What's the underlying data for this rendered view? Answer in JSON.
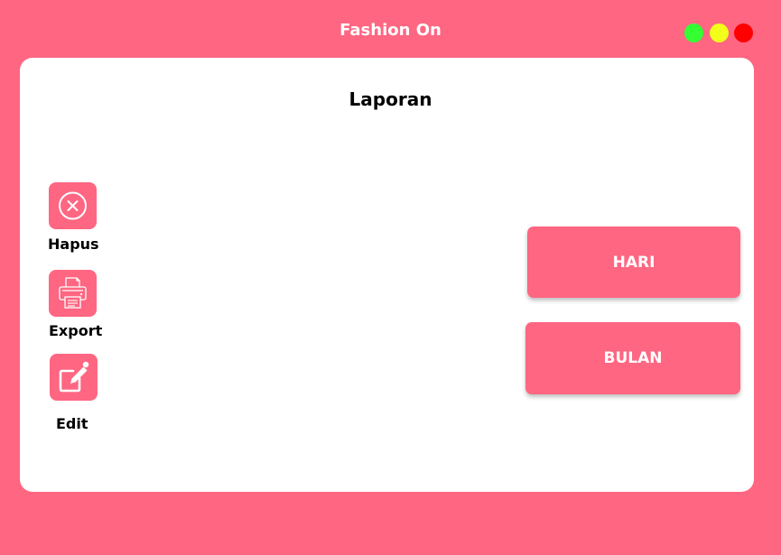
{
  "window": {
    "title": "Fashion On",
    "controls": [
      {
        "name": "maximize",
        "color": "#33ff33"
      },
      {
        "name": "minimize",
        "color": "#f2ff1a"
      },
      {
        "name": "close",
        "color": "#ff0000"
      }
    ]
  },
  "page": {
    "title": "Laporan"
  },
  "actions": [
    {
      "label": "Hapus",
      "icon": "close-circle-icon"
    },
    {
      "label": "Export",
      "icon": "printer-icon"
    },
    {
      "label": "Edit",
      "icon": "edit-icon"
    }
  ],
  "periods": [
    {
      "label": "HARI"
    },
    {
      "label": "BULAN"
    }
  ],
  "colors": {
    "accent": "#ff6682",
    "panel": "#ffffff",
    "text": "#000000"
  }
}
